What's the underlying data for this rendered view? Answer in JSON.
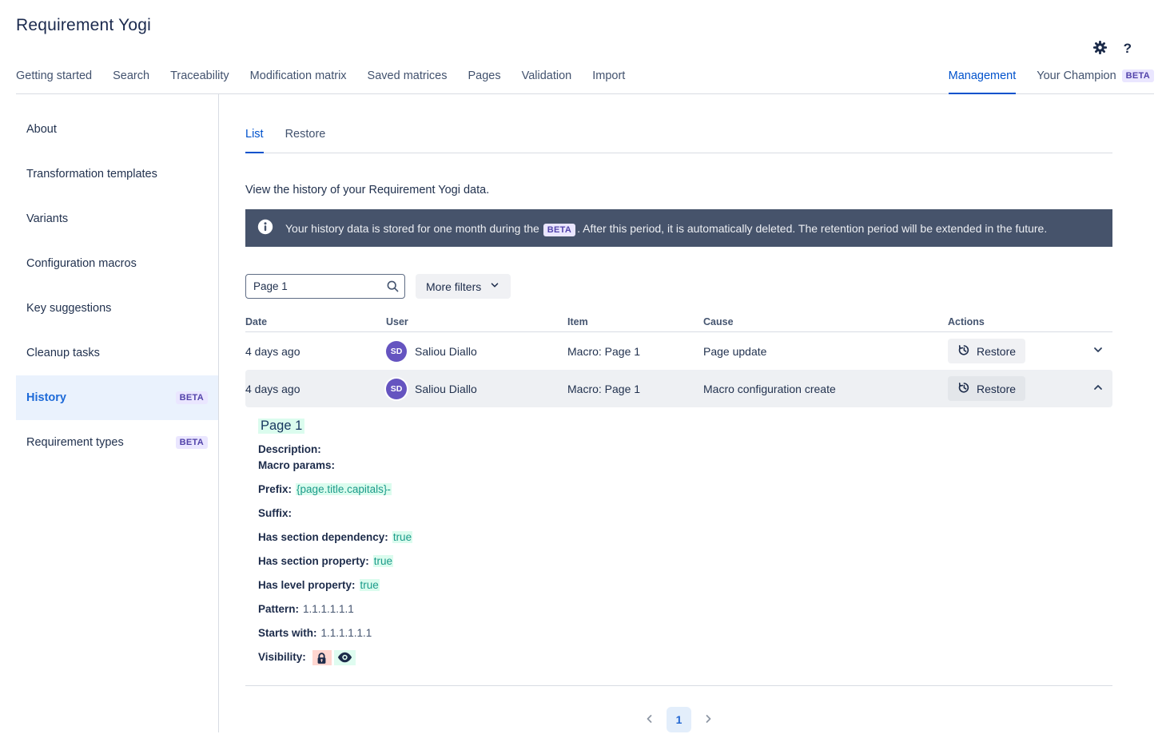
{
  "app": {
    "title": "Requirement Yogi",
    "help_glyph": "?"
  },
  "top_nav": {
    "items": [
      "Getting started",
      "Search",
      "Traceability",
      "Modification matrix",
      "Saved matrices",
      "Pages",
      "Validation",
      "Import"
    ],
    "right_items": [
      {
        "label": "Management",
        "active": true
      },
      {
        "label": "Your Champion",
        "badge": "BETA"
      }
    ]
  },
  "sidebar": {
    "items": [
      {
        "label": "About"
      },
      {
        "label": "Transformation templates"
      },
      {
        "label": "Variants"
      },
      {
        "label": "Configuration macros"
      },
      {
        "label": "Key suggestions"
      },
      {
        "label": "Cleanup tasks"
      },
      {
        "label": "History",
        "badge": "BETA",
        "active": true
      },
      {
        "label": "Requirement types",
        "badge": "BETA"
      }
    ]
  },
  "main": {
    "tabs": [
      {
        "label": "List",
        "active": true
      },
      {
        "label": "Restore"
      }
    ],
    "intro": "View the history of your Requirement Yogi data.",
    "banner": {
      "text_before": "Your history data is stored for one month during the",
      "badge": "BETA",
      "text_after": ". After this period, it is automatically deleted. The retention period will be extended in the future."
    },
    "filters": {
      "search_value": "Page 1",
      "more_filters_label": "More filters"
    },
    "table": {
      "columns": [
        "Date",
        "User",
        "Item",
        "Cause",
        "Actions"
      ],
      "rows": [
        {
          "date": "4 days ago",
          "user_initials": "SD",
          "user": "Saliou Diallo",
          "item": "Macro: Page 1",
          "cause": "Page update",
          "action": "Restore",
          "collapsed": true
        },
        {
          "date": "4 days ago",
          "user_initials": "SD",
          "user": "Saliou Diallo",
          "item": "Macro: Page 1",
          "cause": "Macro configuration create",
          "action": "Restore",
          "expanded": true
        }
      ]
    },
    "detail": {
      "title": "Page 1",
      "fields": [
        {
          "label": "Description:",
          "value": ""
        },
        {
          "label": "Macro params:",
          "value": "",
          "tight": true
        },
        {
          "label": "Prefix:",
          "value": "{page.title.capitals}-",
          "highlight": true
        },
        {
          "label": "Suffix:",
          "value": ""
        },
        {
          "label": "Has section dependency:",
          "value": "true",
          "highlight": true
        },
        {
          "label": "Has section property:",
          "value": "true",
          "highlight": true
        },
        {
          "label": "Has level property:",
          "value": "true",
          "highlight": true
        },
        {
          "label": "Pattern:",
          "value": "1.1.1.1.1.1"
        },
        {
          "label": "Starts with:",
          "value": "1.1.1.1.1.1"
        },
        {
          "label": "Visibility:",
          "value": "",
          "show_icons": true
        }
      ]
    },
    "pagination": {
      "current": "1"
    }
  },
  "colors": {
    "accent": "#0052CC",
    "banner_bg": "#46536B",
    "beta_badge_bg": "#EAE6FF",
    "beta_badge_text": "#5243AA",
    "avatar_bg": "#6554C0",
    "highlight_bg": "#DBFCEE",
    "highlight_text": "#1C9B8A",
    "lock_badge_bg": "#FFD6D0",
    "eye_badge_bg": "#DFFCF0",
    "expanded_row_bg": "#EEF0F3",
    "pagination_active_bg": "#E3EEFB"
  }
}
